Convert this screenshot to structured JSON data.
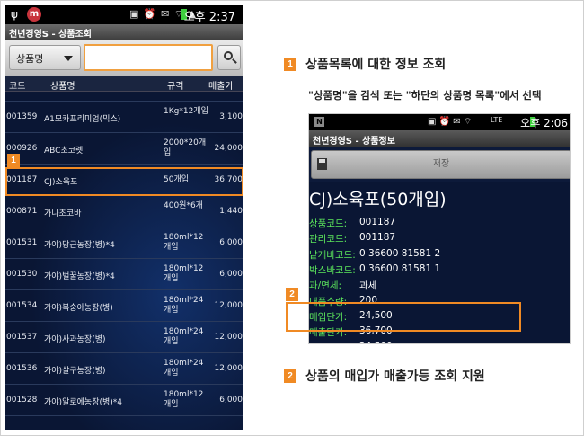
{
  "left_phone": {
    "status_time": "오후 2:37",
    "app_badge": "m",
    "title": "천년경영S - 상품조회",
    "search": {
      "dropdown_label": "상품명",
      "input_value": ""
    },
    "columns": [
      "코드",
      "상품명",
      "규격",
      "매출가"
    ],
    "rows": [
      {
        "code": "",
        "name": "",
        "spec": "개입",
        "price": ""
      },
      {
        "code": "001359",
        "name": "A1모카프리미엄(믹스)",
        "spec": "1Kg*12개입",
        "price": "3,100"
      },
      {
        "code": "000926",
        "name": "ABC초코렛",
        "spec": "2000*20개입",
        "price": "24,000"
      },
      {
        "code": "001187",
        "name": "CJ)소육포",
        "spec": "50개입",
        "price": "36,700"
      },
      {
        "code": "000871",
        "name": "가나초코바",
        "spec": "400원*6개",
        "price": "1,440"
      },
      {
        "code": "001531",
        "name": "가야)당근농장(병)*4",
        "spec": "180ml*12개입",
        "price": "6,000"
      },
      {
        "code": "001530",
        "name": "가야)벌꿀농장(병)*4",
        "spec": "180ml*12개입",
        "price": "6,000"
      },
      {
        "code": "001534",
        "name": "가야)복숭아농장(병)",
        "spec": "180ml*24개입",
        "price": "12,000"
      },
      {
        "code": "001537",
        "name": "가야)사과농장(병)",
        "spec": "180ml*24개입",
        "price": "12,000"
      },
      {
        "code": "001536",
        "name": "가야)살구농장(병)",
        "spec": "180ml*24개입",
        "price": "12,000"
      },
      {
        "code": "001528",
        "name": "가야)알로에농장(병)*4",
        "spec": "180ml*12개입",
        "price": "6,000"
      }
    ],
    "marker": "1"
  },
  "caption1": {
    "num": "1",
    "text": "상품목록에 대한 정보 조회"
  },
  "subcaption": "\"상품명\"을 검색 또는 \"하단의 상품명 목록\"에서 선택",
  "right_phone": {
    "status_time": "오후 2:06",
    "status_n": "N",
    "lte": "LTE",
    "title": "천년경영S - 상품정보",
    "save_label": "저장",
    "product_title": "CJ)소육포(50개입)",
    "fields": [
      {
        "k": "상품코드:",
        "v": "001187"
      },
      {
        "k": "관리코드:",
        "v": "001187"
      },
      {
        "k": "낱개바코드:",
        "v": "0 36600 81581 2"
      },
      {
        "k": "박스바코드:",
        "v": "0 36600 81581 1"
      },
      {
        "k": "과/면세:",
        "v": "과세"
      },
      {
        "k": "내품수량:",
        "v": "200"
      },
      {
        "k": "매입단가:",
        "v": "24,500"
      },
      {
        "k": "매출단가:",
        "v": "36,700"
      },
      {
        "k": "기준단가:",
        "v": "24,500"
      }
    ],
    "marker": "2"
  },
  "caption2": {
    "num": "2",
    "text": "상품의 매입가 매출가등 조회 지원"
  },
  "colors": {
    "accent": "#f08a24",
    "field_key": "#5ce65c",
    "bg": "#0a1634"
  }
}
